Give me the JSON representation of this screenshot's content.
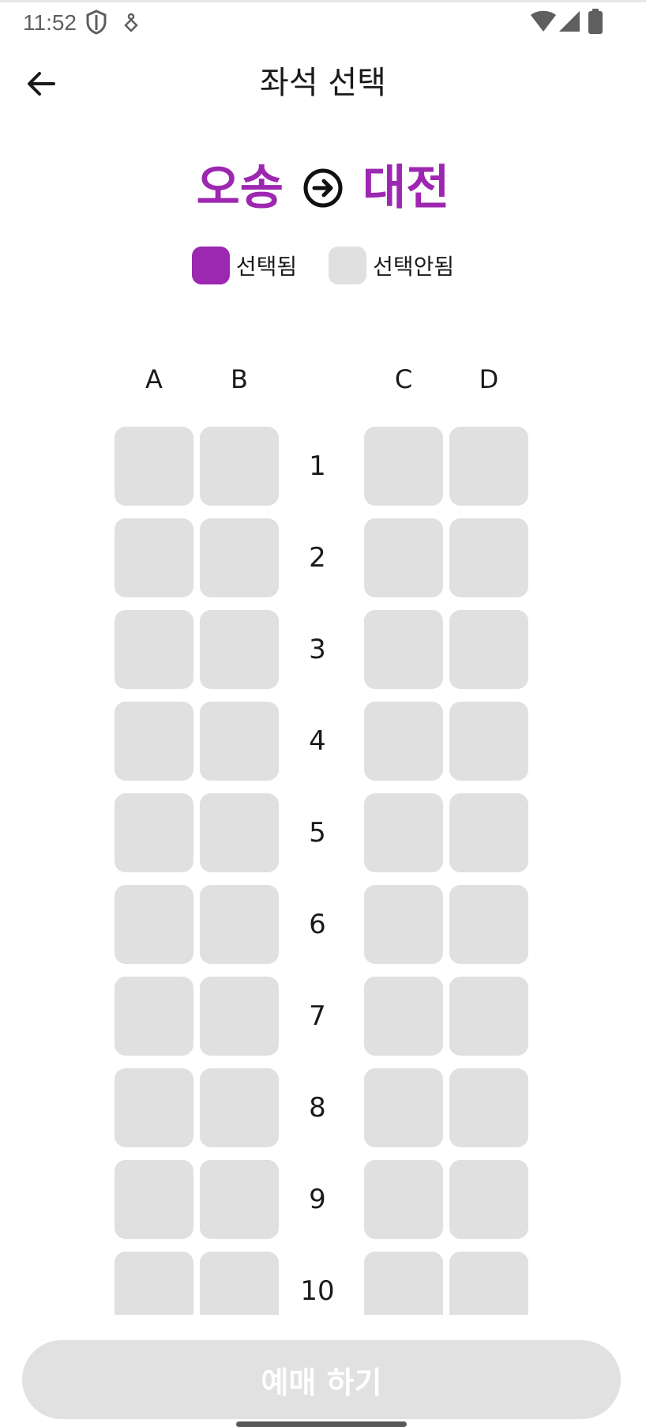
{
  "status_bar": {
    "time": "11:52",
    "icons": [
      "shield-icon",
      "notification-icon",
      "wifi-icon",
      "signal-icon",
      "battery-icon"
    ]
  },
  "app_bar": {
    "title": "좌석 선택",
    "back_icon": "arrow-back-icon"
  },
  "route": {
    "departure": "오송",
    "arrival": "대전",
    "arrow_icon": "arrow-circle-right-icon",
    "color": "#9c27b0"
  },
  "legend": {
    "selected_label": "선택됨",
    "selected_color": "#9c27b0",
    "unselected_label": "선택안됨",
    "unselected_color": "#e0e0e0"
  },
  "seat_map": {
    "columns": [
      "A",
      "B",
      "C",
      "D"
    ],
    "rows": [
      "1",
      "2",
      "3",
      "4",
      "5",
      "6",
      "7",
      "8",
      "9",
      "10"
    ],
    "selected_seats": []
  },
  "footer": {
    "book_label": "예매 하기",
    "enabled": false
  }
}
